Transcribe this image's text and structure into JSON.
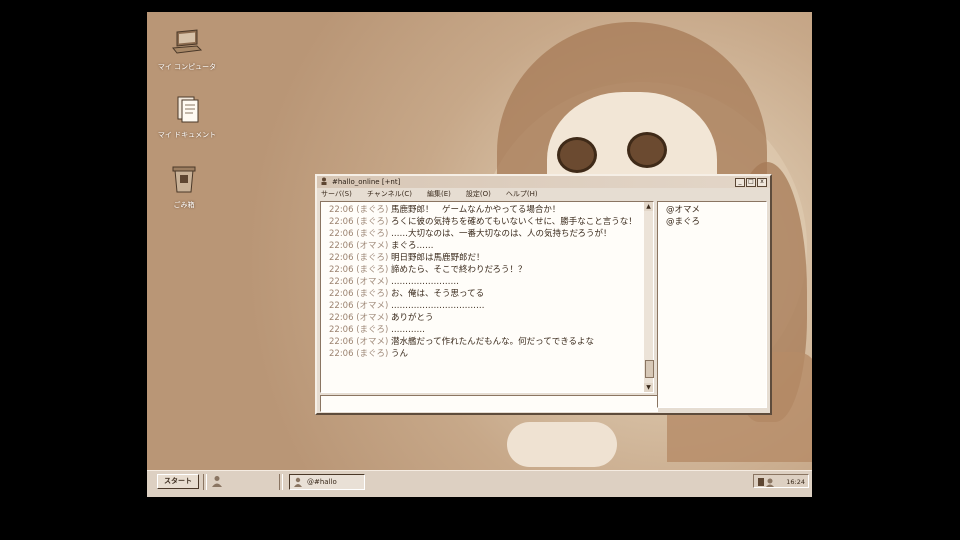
{
  "desktop": {
    "icons": [
      {
        "label": "マイ コンピュータ",
        "icon": "computer-icon"
      },
      {
        "label": "マイ ドキュメント",
        "icon": "documents-icon"
      },
      {
        "label": "ごみ箱",
        "icon": "recycle-bin-icon"
      }
    ]
  },
  "window": {
    "title": "#hallo_online [+nt]",
    "controls": {
      "minimize": "_",
      "maximize": "□",
      "close": "x"
    },
    "menu": [
      "サーバ(S)",
      "チャンネル(C)",
      "編集(E)",
      "設定(O)",
      "ヘルプ(H)"
    ],
    "chat": [
      {
        "time": "22:06",
        "nick": "(まぐろ)",
        "text": "馬鹿野郎！　ゲームなんかやってる場合か！"
      },
      {
        "time": "22:06",
        "nick": "(まぐろ)",
        "text": "ろくに彼の気持ちを確めてもいないくせに、勝手なこと言うな！"
      },
      {
        "time": "22:06",
        "nick": "(まぐろ)",
        "text": "……大切なのは、一番大切なのは、人の気持ちだろうが！"
      },
      {
        "time": "22:06",
        "nick": "(オマメ)",
        "text": "まぐろ……"
      },
      {
        "time": "22:06",
        "nick": "(まぐろ)",
        "text": "明日野郎は馬鹿野郎だ！"
      },
      {
        "time": "22:06",
        "nick": "(まぐろ)",
        "text": "諦めたら、そこで終わりだろう！？"
      },
      {
        "time": "22:06",
        "nick": "(オマメ)",
        "text": "……………………"
      },
      {
        "time": "22:06",
        "nick": "(まぐろ)",
        "text": "お、俺は、そう思ってる"
      },
      {
        "time": "22:06",
        "nick": "(オマメ)",
        "text": "……………………………"
      },
      {
        "time": "22:06",
        "nick": "(オマメ)",
        "text": "ありがとう"
      },
      {
        "time": "22:06",
        "nick": "(まぐろ)",
        "text": "…………"
      },
      {
        "time": "22:06",
        "nick": "(オマメ)",
        "text": "潜水艦だって作れたんだもんな。何だってできるよな"
      },
      {
        "time": "22:06",
        "nick": "(まぐろ)",
        "text": "うん"
      }
    ],
    "scroll": {
      "up": "▲",
      "down": "▼",
      "position": 0.9
    },
    "input_value": "",
    "users": [
      "@オマメ",
      "@まぐろ"
    ]
  },
  "taskbar": {
    "start_label": "スタート",
    "task_label": "@#hallo",
    "clock": "16:24"
  }
}
